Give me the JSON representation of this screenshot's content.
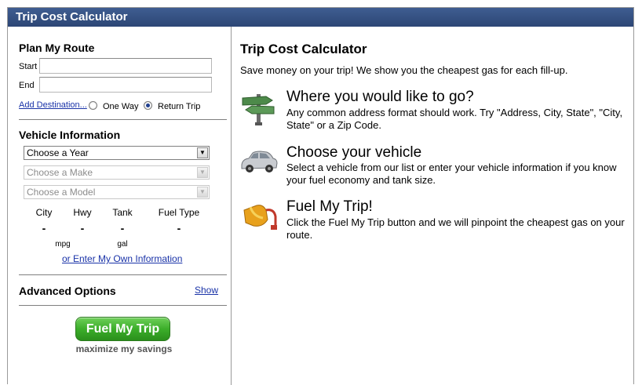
{
  "app": {
    "title": "Trip Cost Calculator"
  },
  "route": {
    "heading": "Plan My Route",
    "start_label": "Start",
    "end_label": "End",
    "start_value": "",
    "end_value": "",
    "add_destination": "Add Destination...",
    "one_way": "One Way",
    "return_trip": "Return Trip",
    "selected": "Return Trip"
  },
  "vehicle": {
    "heading": "Vehicle Information",
    "year": "Choose a Year",
    "make": "Choose a Make",
    "model": "Choose a Model",
    "stats": [
      {
        "label": "City",
        "value": "-",
        "unit": ""
      },
      {
        "label": "Hwy",
        "value": "-",
        "unit": "mpg"
      },
      {
        "label": "Tank",
        "value": "-",
        "unit": "gal"
      },
      {
        "label": "Fuel Type",
        "value": "-",
        "unit": ""
      }
    ],
    "own_info_link": "or Enter My Own Information"
  },
  "advanced": {
    "heading": "Advanced Options",
    "toggle": "Show"
  },
  "action": {
    "button": "Fuel My Trip",
    "tagline": "maximize my savings"
  },
  "info": {
    "title": "Trip Cost Calculator",
    "intro": "Save money on your trip! We show you the cheapest gas for each fill-up.",
    "steps": [
      {
        "icon": "signpost-icon",
        "heading": "Where you would like to go?",
        "text": "Any common address format should work. Try \"Address, City, State\", \"City, State\" or a Zip Code."
      },
      {
        "icon": "car-icon",
        "heading": "Choose your vehicle",
        "text": "Select a vehicle from our list or enter your vehicle information if you know your fuel economy and tank size."
      },
      {
        "icon": "fuel-pump-icon",
        "heading": "Fuel My Trip!",
        "text": "Click the Fuel My Trip button and we will pinpoint the cheapest gas on your route."
      }
    ]
  },
  "colors": {
    "titlebar": "#2c4675",
    "link": "#1a33a8",
    "button_green": "#3cae2a"
  }
}
